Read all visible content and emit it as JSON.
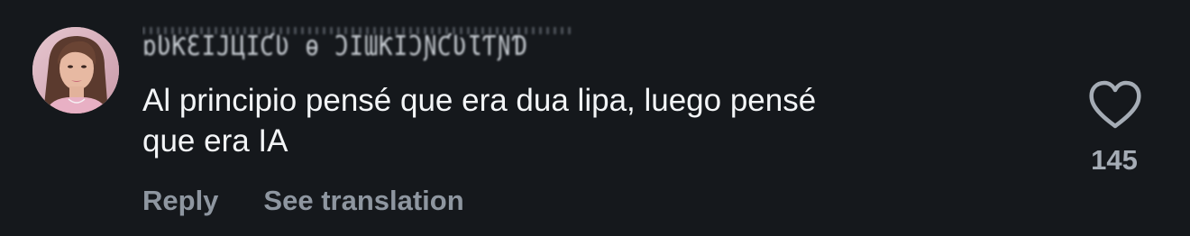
{
  "comment": {
    "username": "ɒƲƘƐIJЦIƇƲ ɵ ƆIƜƘIƆƝƇƲƖƬƝƊ",
    "text_line1": "Al principio pensé que era dua lipa, luego pensé",
    "text_line2": "que era IA",
    "avatar": "user-avatar-photo",
    "actions": {
      "reply_label": "Reply",
      "translate_label": "See translation"
    },
    "like": {
      "icon": "heart-outline-icon",
      "count": "145"
    }
  },
  "colors": {
    "background": "#15181c",
    "text": "#f3f5f7",
    "muted": "#8e96a0"
  }
}
